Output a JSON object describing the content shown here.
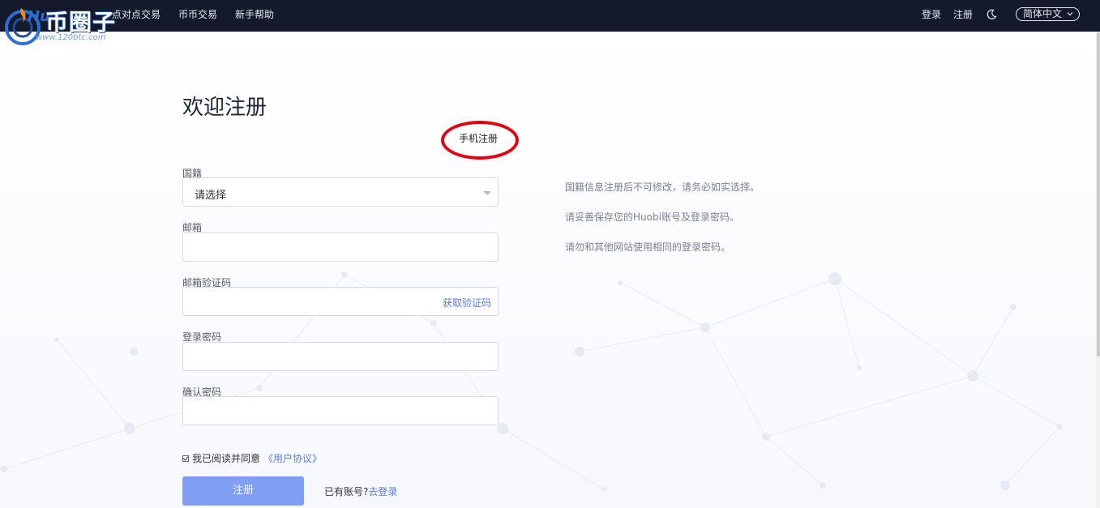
{
  "logo": {
    "main": "币圈子",
    "url": "www.120btc.com",
    "partial": "Hu"
  },
  "nav": {
    "items": [
      "点对点交易",
      "币币交易",
      "新手帮助"
    ]
  },
  "header_right": {
    "login": "登录",
    "register": "注册",
    "language": "简体中文",
    "theme_icon": "moon-icon"
  },
  "page": {
    "title": "欢迎注册",
    "tab": "手机注册",
    "fields": {
      "nationality": {
        "label": "国籍",
        "value": "请选择"
      },
      "email": {
        "label": "邮箱",
        "value": ""
      },
      "email_code": {
        "label": "邮箱验证码",
        "value": "",
        "action": "获取验证码"
      },
      "password": {
        "label": "登录密码",
        "value": ""
      },
      "confirm_password": {
        "label": "确认密码",
        "value": ""
      }
    },
    "agree": {
      "text": "我已阅读并同意",
      "link": "《用户协议》"
    },
    "submit": "注册",
    "has_account": {
      "text": "已有账号?",
      "link": "去登录"
    },
    "tips": [
      "国籍信息注册后不可修改，请务必如实选择。",
      "请妥善保存您的Huobi账号及登录密码。",
      "请勿和其他网站使用相同的登录密码。"
    ]
  },
  "colors": {
    "topbar": "#141a2b",
    "accent": "#5b7ee0",
    "button": "#7f9ff3",
    "highlight_circle": "#e30012"
  }
}
